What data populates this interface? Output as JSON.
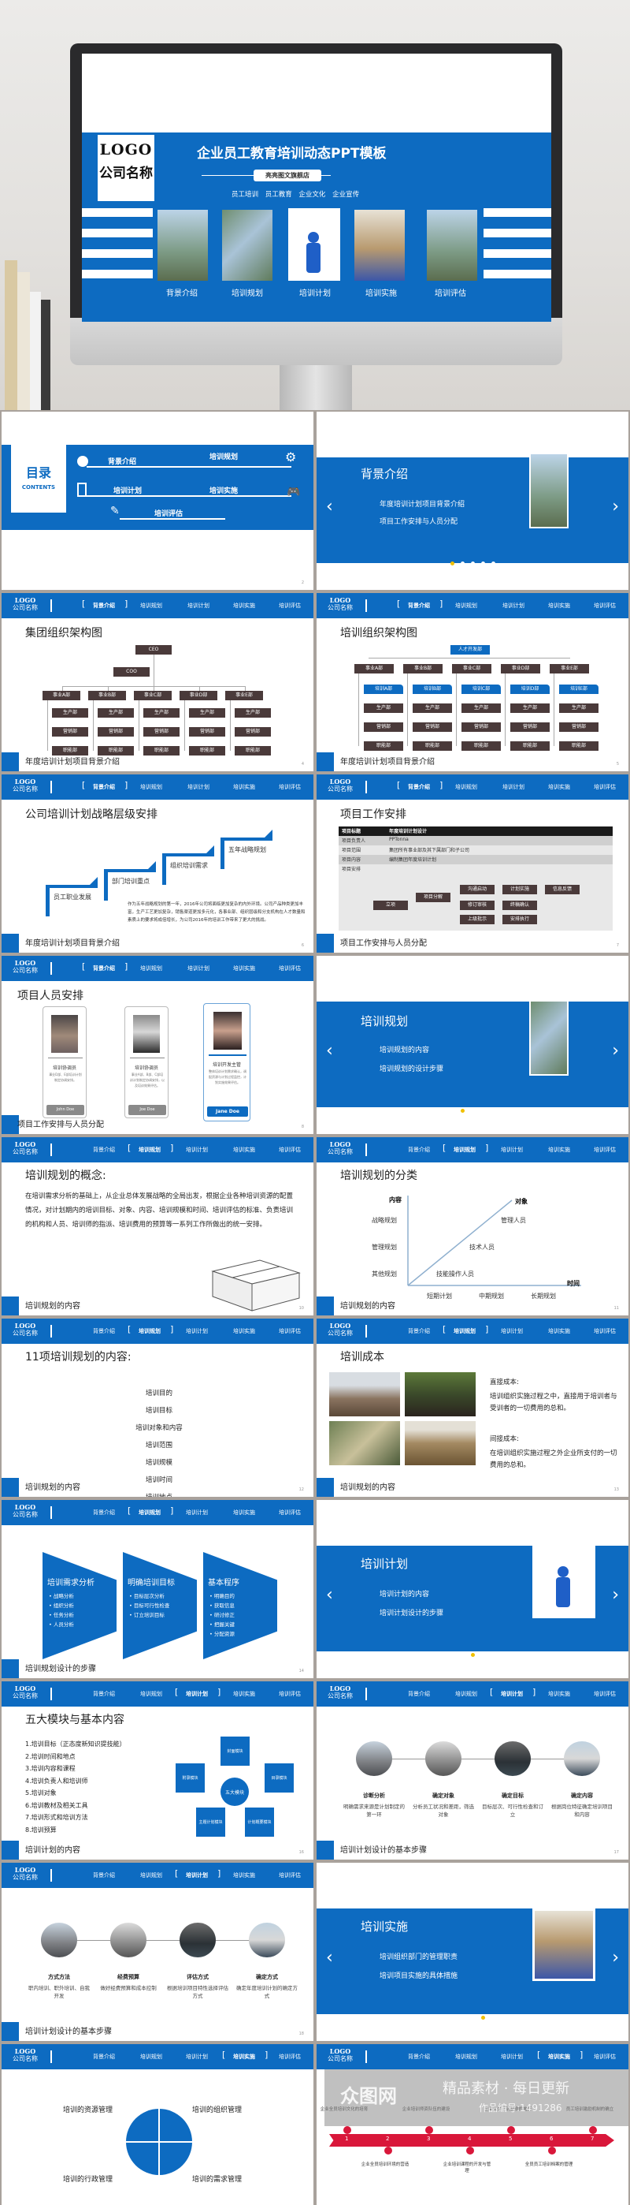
{
  "cover": {
    "logo": "LOGO",
    "company": "公司名称",
    "title": "企业员工教育培训动态PPT模板",
    "shop": "亮亮图文旗舰店",
    "tags": "员工培训  员工教育 企业文化 企业宣传",
    "sections": [
      "背景介绍",
      "培训规划",
      "培训计划",
      "培训实施",
      "培训评估"
    ]
  },
  "header": {
    "logo": "LOGO",
    "company": "公司名称",
    "nav": [
      "背景介绍",
      "培训规划",
      "培训计划",
      "培训实施",
      "培训评估"
    ]
  },
  "toc": {
    "title": "目录",
    "subtitle": "CONTENTS",
    "items": [
      "背景介绍",
      "培训规划",
      "培训计划",
      "培训实施",
      "培训评估"
    ],
    "page": "2"
  },
  "banner_bg": {
    "title": "背景介绍",
    "lines": [
      "年度培训计划项目背景介绍",
      "项目工作安排与人员分配"
    ],
    "active_dot": 1
  },
  "org1": {
    "title": "集团组织架构图",
    "ceo": "CEO",
    "coo": "COO",
    "divisions": [
      "事业A部",
      "事业B部",
      "事业C部",
      "事业D部",
      "事业E部"
    ],
    "subs": [
      "生产部",
      "营销部",
      "职能部"
    ],
    "footer": "年度培训计划项目背景介绍",
    "page": "4"
  },
  "org2": {
    "title": "培训组织架构图",
    "root": "人才开发部",
    "divisions": [
      "事业A部",
      "事业B部",
      "事业C部",
      "事业D部",
      "事业E部"
    ],
    "training": [
      "培训A部",
      "培训B部",
      "培训C部",
      "培训D部",
      "培训E部"
    ],
    "subs": [
      "生产部",
      "营销部",
      "职能部"
    ],
    "footer": "年度培训计划项目背景介绍",
    "page": "5"
  },
  "strategy": {
    "title": "公司培训计划战略层级安排",
    "steps": [
      "员工职业发展",
      "部门培训重点",
      "组织培训需求",
      "五年战略规划"
    ],
    "paragraph": "作为五年战略规划的第一年，2016年公司将面临更加复杂的内外环境。公司产品种类更加丰富，生产工艺更加复杂，销售渠道更加多元化，各事业部、组织层级和分支机构在人才数量和素质上的要求将成倍增长，为公司2016年的培训工作带来了更大的挑战。",
    "footer": "年度培训计划项目背景介绍",
    "page": "6"
  },
  "project": {
    "title": "项目工作安排",
    "rows": [
      {
        "k": "项目标题",
        "v": "年度培训计划设计"
      },
      {
        "k": "项目负责人",
        "v": "PPTonna"
      },
      {
        "k": "项目范围",
        "v": "集团所有事业部及其下属部门和子公司"
      },
      {
        "k": "项目内容",
        "v": "编制集团年度培训计划"
      },
      {
        "k": "项目安排",
        "v": ""
      }
    ],
    "flow": [
      "立项",
      "项目分解",
      "沟通启动",
      "计划实施",
      "信息反馈",
      "修订审核",
      "终稿确认",
      "上级批示",
      "安排执行"
    ],
    "footer": "项目工作安排与人员分配",
    "page": "7"
  },
  "people": {
    "title": "项目人员安排",
    "cards": [
      {
        "role": "培训协调员",
        "desc": "事业D部、E部培训计划制定协调安排。",
        "name": "John Doe"
      },
      {
        "role": "培训协调员",
        "desc": "事业A部、B部、C部培训计划制定协调安排，以及培训效果评估。",
        "name": "Joe Doe"
      },
      {
        "role": "培训开发主管",
        "desc": "整体培训计划需求确认，调配资源与计划过程监控，计划实施效果评估。",
        "name": "Jane Doe"
      }
    ],
    "footer": "项目工作安排与人员分配",
    "page": "8"
  },
  "banner_plan": {
    "title": "培训规划",
    "lines": [
      "培训规划的内容",
      "培训规划的设计步骤"
    ],
    "active_dot": 2
  },
  "concept": {
    "title": "培训规划的概念:",
    "body": "在培训需求分析的基础上，从企业总体发展战略的全局出发，根据企业各种培训资源的配置情况，对计划期内的培训目标、对象、内容、培训规模和时间、培训评估的标准、负责培训的机构和人员、培训师的指派、培训费用的预算等一系列工作所做出的统一安排。",
    "footer": "培训规划的内容",
    "page": "10"
  },
  "classify": {
    "title": "培训规划的分类",
    "y_axis": "内容",
    "x_axis": "时间",
    "diag_axis": "对象",
    "y_labels": [
      "战略规划",
      "管理规划",
      "其他规划"
    ],
    "x_labels": [
      "短期计划",
      "中期规划",
      "长期规划"
    ],
    "diag_labels": [
      "管理人员",
      "技术人员",
      "技能操作人员"
    ],
    "footer": "培训规划的内容",
    "page": "11"
  },
  "eleven": {
    "title": "11项培训规划的内容:",
    "items": [
      "培训目的",
      "培训目标",
      "培训对象和内容",
      "培训范围",
      "培训规模",
      "培训时间",
      "培训地点"
    ],
    "footer": "培训规划的内容",
    "page": "12"
  },
  "cost": {
    "title": "培训成本",
    "direct_h": "直接成本:",
    "direct": "培训组织实施过程之中，直接用于培训者与受训者的一切费用的总和。",
    "indirect_h": "间接成本:",
    "indirect": "在培训组织实施过程之外企业所支付的一切费用的总和。",
    "footer": "培训规划的内容",
    "page": "13"
  },
  "funnels": {
    "blocks": [
      {
        "h": "培训需求分析",
        "items": [
          "战略分析",
          "组织分析",
          "任务分析",
          "人员分析"
        ]
      },
      {
        "h": "明确培训目标",
        "items": [
          "目标层次分析",
          "目标可行性检查",
          "订立培训目标"
        ]
      },
      {
        "h": "基本程序",
        "items": [
          "明确目的",
          "获取信息",
          "研讨修正",
          "把握关键",
          "分配资源"
        ]
      }
    ],
    "footer": "培训规划设计的步骤",
    "page": "14"
  },
  "banner_sched": {
    "title": "培训计划",
    "lines": [
      "培训计划的内容",
      "培训计划设计的步骤"
    ],
    "active_dot": 3
  },
  "modules": {
    "title": "五大模块与基本内容",
    "list": [
      "1.培训目标（正态度新知识提技能）",
      "2.培训时间和地点",
      "3.培训内容和课程",
      "4.培训负责人和培训师",
      "5.培训对象",
      "6.培训教材及相关工具",
      "7.培训形式和培训方法",
      "8.培训预算"
    ],
    "center": "五大模块",
    "mods": [
      "封面模块",
      "目录模块",
      "计划概要模块",
      "主题计划模块",
      "附录模块"
    ],
    "footer": "培训计划的内容",
    "page": "16"
  },
  "steps1": {
    "items": [
      {
        "name": "诊断分析",
        "desc": "明确需求来源是计划制定的第一环"
      },
      {
        "name": "确定对象",
        "desc": "分析员工状况和差距，筛选对象"
      },
      {
        "name": "确定目标",
        "desc": "目标层次、可行性检查和订立"
      },
      {
        "name": "确定内容",
        "desc": "根据岗位特征确定培训项目和内容"
      }
    ],
    "footer": "培训计划设计的基本步骤",
    "page": "17"
  },
  "steps2": {
    "items": [
      {
        "name": "方式方法",
        "desc": "职内培训、职外培训、自我开发"
      },
      {
        "name": "经费预算",
        "desc": "做好经费预算和成本控制"
      },
      {
        "name": "评估方式",
        "desc": "根据培训项目特性选择评估方式"
      },
      {
        "name": "确定方式",
        "desc": "确定年度培训计划的确定方式"
      }
    ],
    "footer": "培训计划设计的基本步骤",
    "page": "18"
  },
  "banner_impl": {
    "title": "培训实施",
    "lines": [
      "培训组织部门的管理职责",
      "培训项目实施的具体措施"
    ],
    "active_dot": 4
  },
  "quad": {
    "labels": [
      "培训的资源管理",
      "培训的组织管理",
      "培训的行政管理",
      "培训的需求管理"
    ]
  },
  "timeline": {
    "top": [
      "企业全员培训文化的培育",
      "企业培训师资队伍的建设",
      "企业全员培训制度的施行",
      "员工培训激励机制的确立"
    ],
    "bottom": [
      "企业全员培训环境的营造",
      "企业培训课程的开发与管理",
      "全员员工培训档案的管理"
    ],
    "numbers": [
      "1",
      "2",
      "3",
      "4",
      "5",
      "6",
      "7"
    ],
    "watermark": "精品素材 · 每日更新",
    "watermark_logo": "众图网",
    "watermark_id": "作品编号:1491286"
  }
}
